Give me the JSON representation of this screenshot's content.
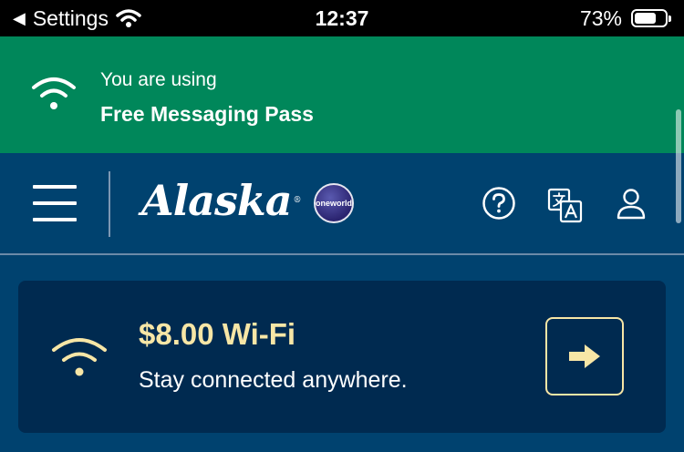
{
  "status_bar": {
    "back_label": "Settings",
    "time": "12:37",
    "battery_percent": "73%",
    "battery_level": 0.73
  },
  "pass_banner": {
    "line1": "You are using",
    "line2": "Free Messaging Pass",
    "icon": "wifi-icon"
  },
  "header": {
    "logo_text": "Alaska",
    "logo_mark": "®",
    "badge_text": "oneworld",
    "icons": [
      "menu-icon",
      "help-icon",
      "translate-icon",
      "profile-icon"
    ]
  },
  "wifi_card": {
    "title": "$8.00 Wi-Fi",
    "subtitle": "Stay connected anywhere.",
    "icon": "wifi-icon",
    "action_icon": "arrow-right-icon"
  },
  "colors": {
    "status_bar_bg": "#000000",
    "banner_green": "#00875a",
    "header_blue": "#00426f",
    "card_navy": "#002a50",
    "accent_gold": "#f7e6a6"
  }
}
